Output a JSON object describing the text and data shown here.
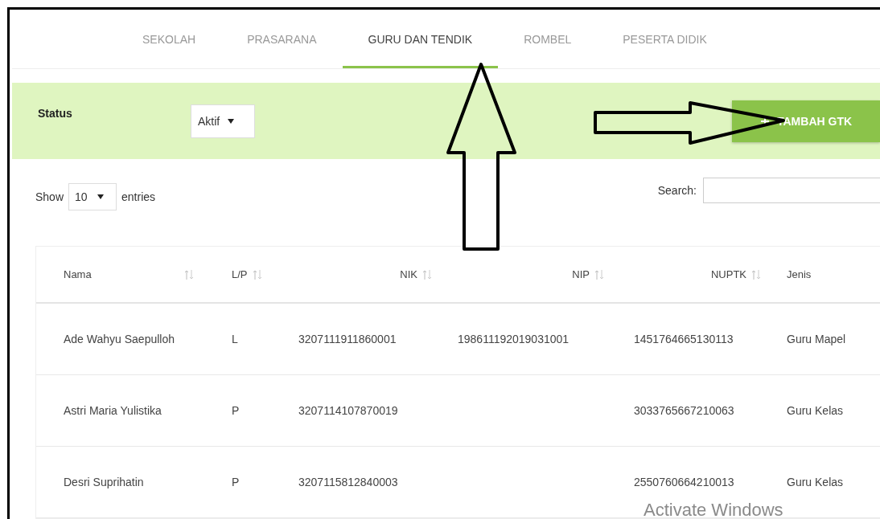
{
  "tabs": [
    {
      "label": "SEKOLAH",
      "selected": false
    },
    {
      "label": "PRASARANA",
      "selected": false
    },
    {
      "label": "GURU DAN TENDIK",
      "selected": true
    },
    {
      "label": "ROMBEL",
      "selected": false
    },
    {
      "label": "PESERTA DIDIK",
      "selected": false
    }
  ],
  "filter_panel": {
    "status_label": "Status",
    "status_value": "Aktif",
    "add_button": "TAMBAH GTK"
  },
  "length_control": {
    "show": "Show",
    "value": "10",
    "entries": "entries"
  },
  "search": {
    "label": "Search:"
  },
  "table": {
    "columns": [
      {
        "label": "Nama",
        "sortable": true
      },
      {
        "label": "L/P",
        "sortable": true
      },
      {
        "label": "NIK",
        "sortable": true
      },
      {
        "label": "NIP",
        "sortable": true
      },
      {
        "label": "NUPTK",
        "sortable": true
      },
      {
        "label": "Jenis",
        "sortable": false
      }
    ],
    "rows": [
      [
        "Ade Wahyu Saepulloh",
        "L",
        "3207111911860001",
        "198611192019031001",
        "1451764665130113",
        "Guru Mapel"
      ],
      [
        "Astri Maria Yulistika",
        "P",
        "3207114107870019",
        "",
        "3033765667210063",
        "Guru Kelas"
      ],
      [
        "Desri Suprihatin",
        "P",
        "3207115812840003",
        "",
        "2550760664210013",
        "Guru Kelas"
      ]
    ]
  },
  "os_notice": "Activate Windows"
}
